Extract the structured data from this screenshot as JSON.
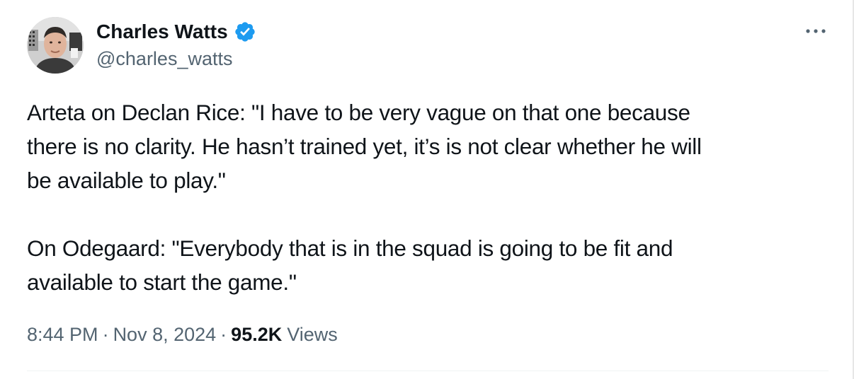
{
  "author": {
    "display_name": "Charles Watts",
    "handle": "@charles_watts",
    "verified": true,
    "verified_badge_color": "#1d9bf0"
  },
  "icons": {
    "avatar": "profile-photo",
    "verified": "verified-badge-icon",
    "more": "more-horizontal-icon"
  },
  "tweet": {
    "text": "Arteta on Declan Rice: \"I have to be very vague on that one because\nthere is no clarity. He hasn’t trained yet, it’s is not clear whether he will\nbe available to play.\"\n\nOn Odegaard: \"Everybody that is in the squad is going to be fit and\navailable to start the game.\""
  },
  "meta": {
    "time": "8:44 PM",
    "separator": "·",
    "date": "Nov 8, 2024",
    "views_count": "95.2K",
    "views_label": "Views"
  },
  "colors": {
    "primary_text": "#0f1419",
    "secondary_text": "#536471",
    "divider": "#eff3f4"
  }
}
